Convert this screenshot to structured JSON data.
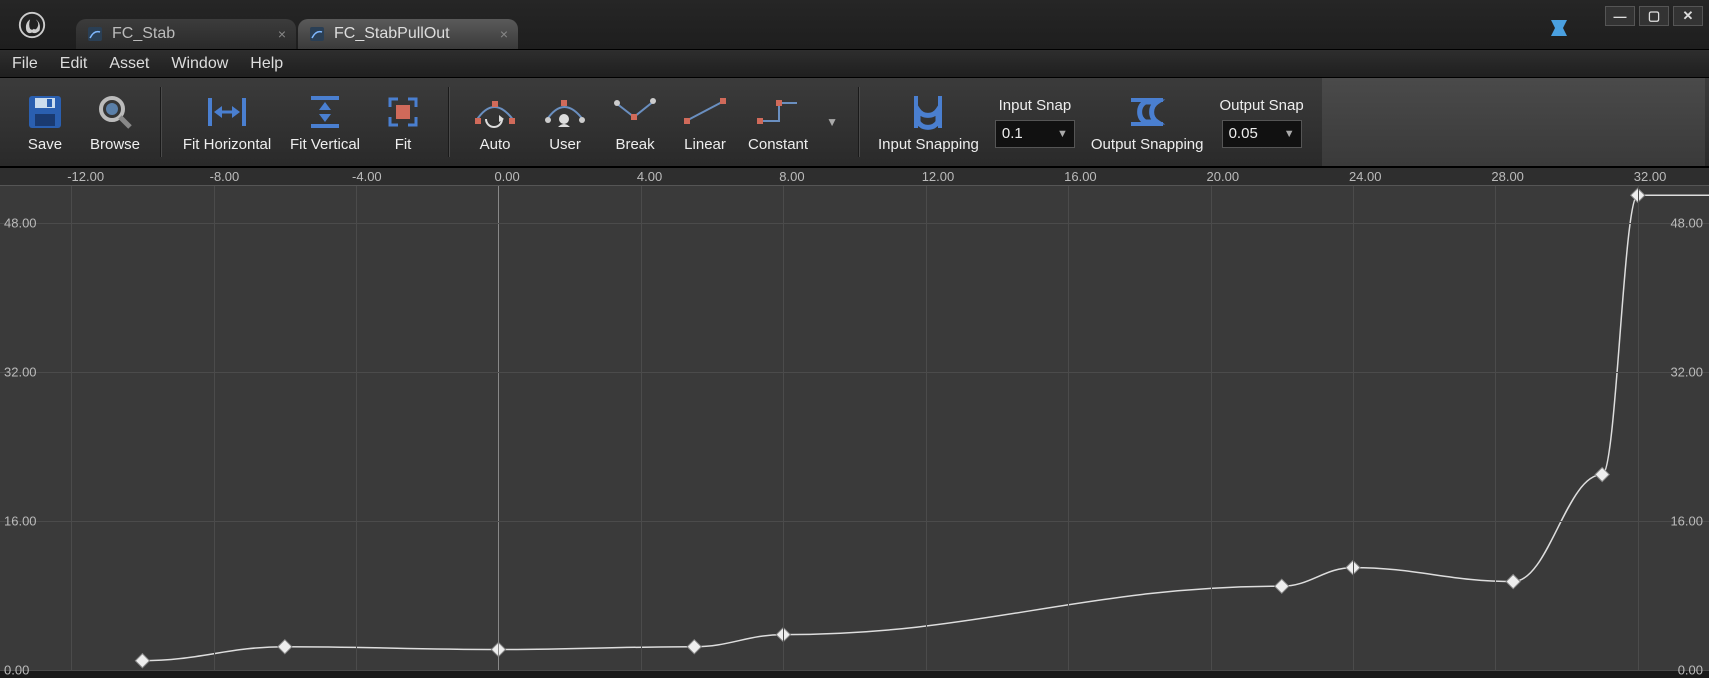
{
  "tabs": [
    {
      "label": "FC_Stab",
      "active": false
    },
    {
      "label": "FC_StabPullOut",
      "active": true
    }
  ],
  "menubar": [
    "File",
    "Edit",
    "Asset",
    "Window",
    "Help"
  ],
  "toolbar": {
    "save": "Save",
    "browse": "Browse",
    "fit_h": "Fit Horizontal",
    "fit_v": "Fit Vertical",
    "fit": "Fit",
    "auto": "Auto",
    "user": "User",
    "break": "Break",
    "linear": "Linear",
    "constant": "Constant",
    "input_snapping": "Input Snapping",
    "input_snap_label": "Input Snap",
    "input_snap_value": "0.1",
    "output_snapping": "Output Snapping",
    "output_snap_label": "Output Snap",
    "output_snap_value": "0.05"
  },
  "chart_data": {
    "type": "line",
    "title": "",
    "xlabel": "",
    "ylabel": "",
    "xlim": [
      -14,
      34
    ],
    "ylim": [
      0,
      52
    ],
    "x_ticks": [
      -12,
      -8,
      -4,
      0,
      4,
      8,
      12,
      16,
      20,
      24,
      28,
      32
    ],
    "y_ticks": [
      0,
      16,
      32,
      48
    ],
    "series": [
      {
        "name": "curve",
        "points": [
          {
            "x": -10.0,
            "y": 1.0
          },
          {
            "x": -6.0,
            "y": 2.5
          },
          {
            "x": 0.0,
            "y": 2.2
          },
          {
            "x": 5.5,
            "y": 2.5
          },
          {
            "x": 8.0,
            "y": 3.8
          },
          {
            "x": 22.0,
            "y": 9.0
          },
          {
            "x": 24.0,
            "y": 11.0
          },
          {
            "x": 28.5,
            "y": 9.5
          },
          {
            "x": 31.0,
            "y": 21.0
          },
          {
            "x": 32.0,
            "y": 51.0
          }
        ]
      }
    ]
  }
}
